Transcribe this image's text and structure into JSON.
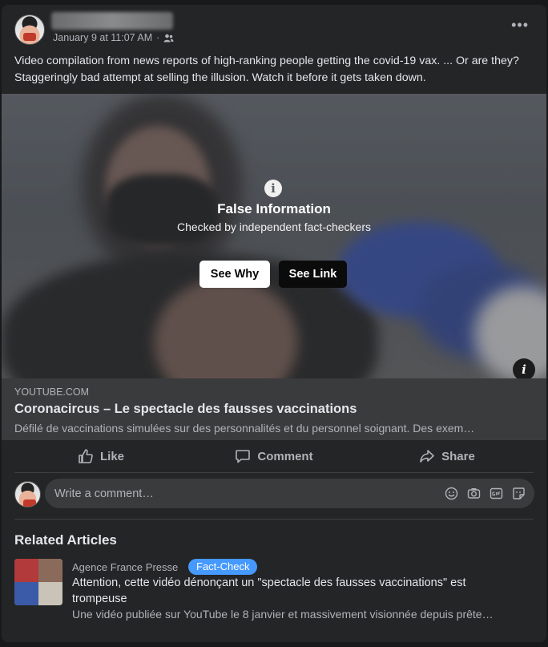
{
  "post": {
    "timestamp": "January 9 at 11:07 AM",
    "separator": "·",
    "text": "Video compilation from news reports of high-ranking people getting the covid-19 vax. ... Or are they?  Staggeringly bad attempt at selling the illusion. Watch it before it gets taken down."
  },
  "fact_check": {
    "title": "False Information",
    "subtitle": "Checked by independent fact-checkers",
    "see_why": "See Why",
    "see_link": "See Link"
  },
  "link_preview": {
    "domain": "YOUTUBE.COM",
    "title": "Coronacircus – Le spectacle des fausses vaccinations",
    "description": "Défilé de vaccinations simulées sur des personnalités et du personnel soignant. Des exem…"
  },
  "actions": {
    "like": "Like",
    "comment": "Comment",
    "share": "Share"
  },
  "comment_box": {
    "placeholder": "Write a comment…"
  },
  "related": {
    "heading": "Related Articles",
    "source": "Agence France Presse",
    "badge": "Fact-Check",
    "title": "Attention, cette vidéo dénonçant un \"spectacle des fausses vaccinations\" est trompeuse",
    "description": "Une vidéo publiée sur YouTube le 8 janvier et massivement visionnée depuis prête…"
  },
  "colors": {
    "background": "#18191a",
    "card": "#242526",
    "accent": "#4599ff"
  },
  "icons": [
    "more-options-icon",
    "friends-audience-icon",
    "info-icon",
    "like-icon",
    "comment-icon",
    "share-icon",
    "emoji-icon",
    "camera-icon",
    "gif-icon",
    "sticker-icon"
  ]
}
